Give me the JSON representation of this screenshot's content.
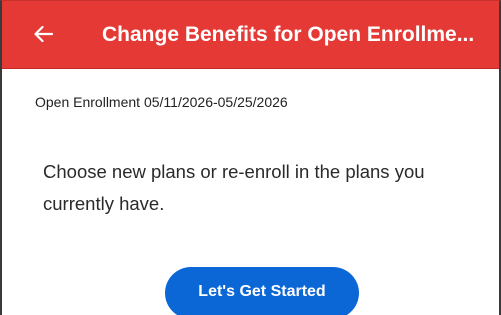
{
  "header": {
    "title": "Change Benefits for Open Enrollme...",
    "back_icon": "arrow-left-icon",
    "background_color": "#e53935"
  },
  "enrollment": {
    "period_label": "Open Enrollment 05/11/2026-05/25/2026"
  },
  "main": {
    "description": "Choose new plans or re-enroll in the plans you currently have.",
    "start_button_label": "Let's Get Started",
    "button_color": "#0b66d6"
  }
}
